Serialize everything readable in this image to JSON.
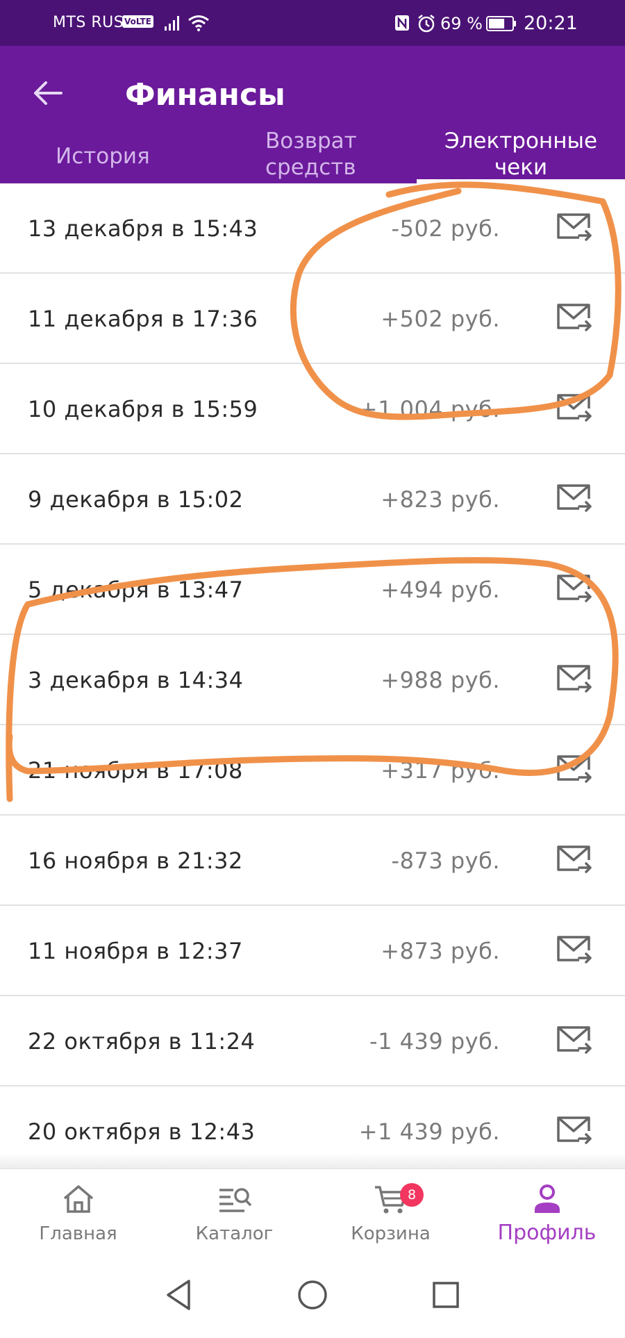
{
  "status_bar": {
    "carrier": "MTS RUS",
    "volte": "VoLTE",
    "battery_percent": "69 %",
    "battery_level": 0.69,
    "time": "20:21",
    "icons": [
      "signal-icon",
      "wifi-icon",
      "nfc-icon",
      "alarm-icon",
      "battery-icon"
    ]
  },
  "header": {
    "title": "Финансы",
    "back_icon": "arrow-left-icon"
  },
  "tabs": [
    {
      "label": "История",
      "active": false
    },
    {
      "label": "Возврат средств",
      "line1": "Возврат",
      "line2": "средств",
      "active": false
    },
    {
      "label": "Электронные чеки",
      "line1": "Электронные",
      "line2": "чеки",
      "active": true
    }
  ],
  "receipts": [
    {
      "date": "13 декабря в 15:43",
      "amount": "-502 руб."
    },
    {
      "date": "11 декабря в 17:36",
      "amount": "+502 руб."
    },
    {
      "date": "10 декабря в 15:59",
      "amount": "+1 004 руб."
    },
    {
      "date": "9 декабря в 15:02",
      "amount": "+823 руб."
    },
    {
      "date": "5 декабря в 13:47",
      "amount": "+494 руб."
    },
    {
      "date": "3 декабря в 14:34",
      "amount": "+988 руб."
    },
    {
      "date": "21 ноября в 17:08",
      "amount": "+317 руб."
    },
    {
      "date": "16 ноября в 21:32",
      "amount": "-873 руб."
    },
    {
      "date": "11 ноября в 12:37",
      "amount": "+873 руб."
    },
    {
      "date": "22 октября в 11:24",
      "amount": "-1 439 руб."
    },
    {
      "date": "20 октября в 12:43",
      "amount": "+1 439 руб."
    }
  ],
  "row_icon": "mail-forward-icon",
  "bottom_nav": {
    "items": [
      {
        "label": "Главная",
        "icon": "home-icon",
        "active": false
      },
      {
        "label": "Каталог",
        "icon": "catalog-search-icon",
        "active": false
      },
      {
        "label": "Корзина",
        "icon": "cart-icon",
        "active": false,
        "badge": "8"
      },
      {
        "label": "Профиль",
        "icon": "profile-icon",
        "active": true
      }
    ]
  },
  "system_nav": {
    "icons": [
      "back-triangle-icon",
      "home-circle-icon",
      "recents-square-icon"
    ]
  },
  "colors": {
    "status_bar": "#4a1275",
    "app_bar": "#6b1a9b",
    "accent": "#a43ec2",
    "badge": "#f2365f",
    "annotation": "#f0914a"
  }
}
